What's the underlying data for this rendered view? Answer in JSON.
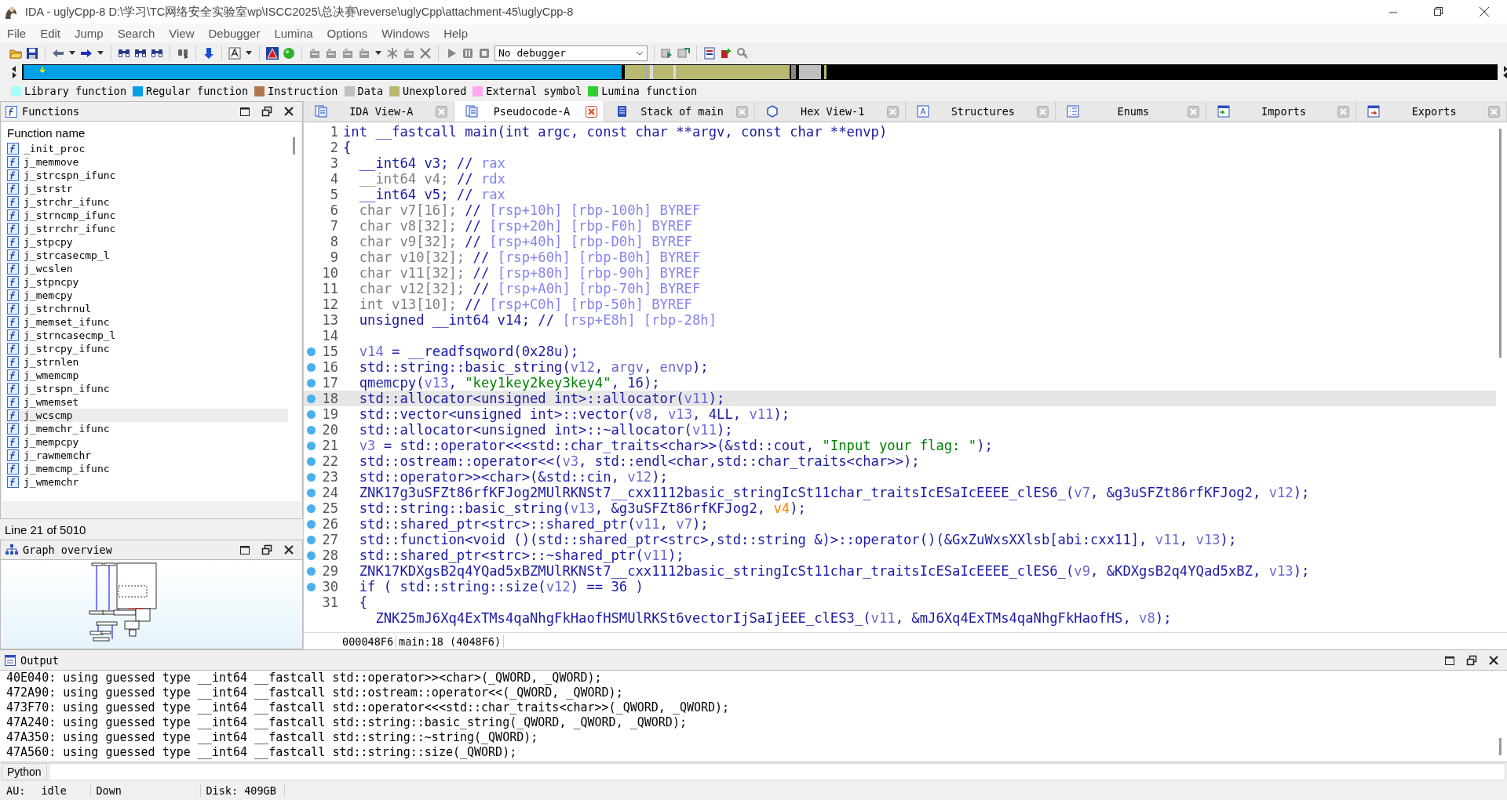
{
  "window": {
    "title": "IDA - uglyCpp-8 D:\\学习\\TC网络安全实验室wp\\ISCC2025\\总决赛\\reverse\\uglyCpp\\attachment-45\\uglyCpp-8"
  },
  "menu": [
    "File",
    "Edit",
    "Jump",
    "Search",
    "View",
    "Debugger",
    "Lumina",
    "Options",
    "Windows",
    "Help"
  ],
  "toolbar": {
    "debugger": "No debugger"
  },
  "legend": [
    {
      "label": "Library function",
      "color": "#aaffff"
    },
    {
      "label": "Regular function",
      "color": "#00a0e8"
    },
    {
      "label": "Instruction",
      "color": "#b07850"
    },
    {
      "label": "Data",
      "color": "#c0c0c0"
    },
    {
      "label": "Unexplored",
      "color": "#b8b870"
    },
    {
      "label": "External symbol",
      "color": "#ffa8f0"
    },
    {
      "label": "Lumina function",
      "color": "#30d030"
    }
  ],
  "functions_panel": {
    "title": "Functions",
    "column": "Function name",
    "status": "Line 21 of 5010",
    "items": [
      {
        "name": "_init_proc",
        "selected": false
      },
      {
        "name": "j_memmove",
        "selected": false
      },
      {
        "name": "j_strcspn_ifunc",
        "selected": false
      },
      {
        "name": "j_strstr",
        "selected": false
      },
      {
        "name": "j_strchr_ifunc",
        "selected": false
      },
      {
        "name": "j_strncmp_ifunc",
        "selected": false
      },
      {
        "name": "j_strrchr_ifunc",
        "selected": false
      },
      {
        "name": "j_stpcpy",
        "selected": false
      },
      {
        "name": "j_strcasecmp_l",
        "selected": false
      },
      {
        "name": "j_wcslen",
        "selected": false
      },
      {
        "name": "j_stpncpy",
        "selected": false
      },
      {
        "name": "j_memcpy",
        "selected": false
      },
      {
        "name": "j_strchrnul",
        "selected": false
      },
      {
        "name": "j_memset_ifunc",
        "selected": false
      },
      {
        "name": "j_strncasecmp_l",
        "selected": false
      },
      {
        "name": "j_strcpy_ifunc",
        "selected": false
      },
      {
        "name": "j_strnlen",
        "selected": false
      },
      {
        "name": "j_wmemcmp",
        "selected": false
      },
      {
        "name": "j_strspn_ifunc",
        "selected": false
      },
      {
        "name": "j_wmemset",
        "selected": false
      },
      {
        "name": "j_wcscmp",
        "selected": true
      },
      {
        "name": "j_memchr_ifunc",
        "selected": false
      },
      {
        "name": "j_mempcpy",
        "selected": false
      },
      {
        "name": "j_rawmemchr",
        "selected": false
      },
      {
        "name": "j_memcmp_ifunc",
        "selected": false
      },
      {
        "name": "j_wmemchr",
        "selected": false
      }
    ]
  },
  "graph_panel": {
    "title": "Graph overview"
  },
  "tabs": [
    {
      "label": "IDA View-A",
      "selected": false
    },
    {
      "label": "Pseudocode-A",
      "selected": true
    },
    {
      "label": "Stack of main",
      "selected": false
    },
    {
      "label": "Hex View-1",
      "selected": false
    },
    {
      "label": "Structures",
      "selected": false
    },
    {
      "label": "Enums",
      "selected": false
    },
    {
      "label": "Imports",
      "selected": false
    },
    {
      "label": "Exports",
      "selected": false
    }
  ],
  "code": {
    "address": "000048F6",
    "location": "main:18 (4048F6)",
    "lines": [
      {
        "num": "1",
        "marked": false,
        "selected": false,
        "parts": [
          {
            "kind": "c",
            "text": "int __fastcall main(int argc, const char **argv, const char **envp)"
          }
        ]
      },
      {
        "num": "2",
        "marked": false,
        "selected": false,
        "parts": [
          {
            "kind": "c",
            "text": "{"
          }
        ]
      },
      {
        "num": "3",
        "marked": false,
        "selected": false,
        "parts": [
          {
            "kind": "c",
            "text": "  __int64 v3; // "
          },
          {
            "kind": "m",
            "text": "rax"
          }
        ]
      },
      {
        "num": "4",
        "marked": false,
        "selected": false,
        "parts": [
          {
            "kind": "g",
            "text": "  __int64 v4; "
          },
          {
            "kind": "c",
            "text": "// "
          },
          {
            "kind": "m",
            "text": "rdx"
          }
        ]
      },
      {
        "num": "5",
        "marked": false,
        "selected": false,
        "parts": [
          {
            "kind": "c",
            "text": "  __int64 v5; // "
          },
          {
            "kind": "m",
            "text": "rax"
          }
        ]
      },
      {
        "num": "6",
        "marked": false,
        "selected": false,
        "parts": [
          {
            "kind": "g",
            "text": "  char v7[16]; "
          },
          {
            "kind": "c",
            "text": "// "
          },
          {
            "kind": "m",
            "text": "[rsp+10h] [rbp-100h] BYREF"
          }
        ]
      },
      {
        "num": "7",
        "marked": false,
        "selected": false,
        "parts": [
          {
            "kind": "g",
            "text": "  char v8[32]; "
          },
          {
            "kind": "c",
            "text": "// "
          },
          {
            "kind": "m",
            "text": "[rsp+20h] [rbp-F0h] BYREF"
          }
        ]
      },
      {
        "num": "8",
        "marked": false,
        "selected": false,
        "parts": [
          {
            "kind": "g",
            "text": "  char v9[32]; "
          },
          {
            "kind": "c",
            "text": "// "
          },
          {
            "kind": "m",
            "text": "[rsp+40h] [rbp-D0h] BYREF"
          }
        ]
      },
      {
        "num": "9",
        "marked": false,
        "selected": false,
        "parts": [
          {
            "kind": "g",
            "text": "  char v10[32]; "
          },
          {
            "kind": "c",
            "text": "// "
          },
          {
            "kind": "m",
            "text": "[rsp+60h] [rbp-B0h] BYREF"
          }
        ]
      },
      {
        "num": "10",
        "marked": false,
        "selected": false,
        "parts": [
          {
            "kind": "g",
            "text": "  char v11[32]; "
          },
          {
            "kind": "c",
            "text": "// "
          },
          {
            "kind": "m",
            "text": "[rsp+80h] [rbp-90h] BYREF"
          }
        ]
      },
      {
        "num": "11",
        "marked": false,
        "selected": false,
        "parts": [
          {
            "kind": "g",
            "text": "  char v12[32]; "
          },
          {
            "kind": "c",
            "text": "// "
          },
          {
            "kind": "m",
            "text": "[rsp+A0h] [rbp-70h] BYREF"
          }
        ]
      },
      {
        "num": "12",
        "marked": false,
        "selected": false,
        "parts": [
          {
            "kind": "g",
            "text": "  int v13[10]; "
          },
          {
            "kind": "c",
            "text": "// "
          },
          {
            "kind": "m",
            "text": "[rsp+C0h] [rbp-50h] BYREF"
          }
        ]
      },
      {
        "num": "13",
        "marked": false,
        "selected": false,
        "parts": [
          {
            "kind": "c",
            "text": "  unsigned __int64 v14; // "
          },
          {
            "kind": "m",
            "text": "[rsp+E8h] [rbp-28h]"
          }
        ]
      },
      {
        "num": "14",
        "marked": false,
        "selected": false
      },
      {
        "num": "15",
        "marked": true,
        "selected": false,
        "parts": [
          {
            "kind": "v",
            "text": "  v14"
          },
          {
            "kind": "c",
            "text": " = __readfsqword(0x28u);"
          }
        ]
      },
      {
        "num": "16",
        "marked": true,
        "selected": false,
        "parts": [
          {
            "kind": "c",
            "text": "  std::string::basic_string("
          },
          {
            "kind": "v",
            "text": "v12"
          },
          {
            "kind": "c",
            "text": ", "
          },
          {
            "kind": "v",
            "text": "argv"
          },
          {
            "kind": "c",
            "text": ", "
          },
          {
            "kind": "v",
            "text": "envp"
          },
          {
            "kind": "c",
            "text": ");"
          }
        ]
      },
      {
        "num": "17",
        "marked": true,
        "selected": false,
        "parts": [
          {
            "kind": "c",
            "text": "  qmemcpy("
          },
          {
            "kind": "v",
            "text": "v13"
          },
          {
            "kind": "c",
            "text": ", "
          },
          {
            "kind": "s",
            "text": "\"key1key2key3key4\""
          },
          {
            "kind": "c",
            "text": ", 16);"
          }
        ]
      },
      {
        "num": "18",
        "marked": true,
        "selected": true,
        "parts": [
          {
            "kind": "c",
            "text": "  std::allocator<unsigned int>::allocator("
          },
          {
            "kind": "v",
            "text": "v11"
          },
          {
            "kind": "c",
            "text": ");"
          }
        ]
      },
      {
        "num": "19",
        "marked": true,
        "selected": false,
        "parts": [
          {
            "kind": "c",
            "text": "  std::vector<unsigned int>::vector("
          },
          {
            "kind": "v",
            "text": "v8"
          },
          {
            "kind": "c",
            "text": ", "
          },
          {
            "kind": "v",
            "text": "v13"
          },
          {
            "kind": "c",
            "text": ", 4LL, "
          },
          {
            "kind": "v",
            "text": "v11"
          },
          {
            "kind": "c",
            "text": ");"
          }
        ]
      },
      {
        "num": "20",
        "marked": true,
        "selected": false,
        "parts": [
          {
            "kind": "c",
            "text": "  std::allocator<unsigned int>::~allocator("
          },
          {
            "kind": "v",
            "text": "v11"
          },
          {
            "kind": "c",
            "text": ");"
          }
        ]
      },
      {
        "num": "21",
        "marked": true,
        "selected": false,
        "parts": [
          {
            "kind": "v",
            "text": "  v3"
          },
          {
            "kind": "c",
            "text": " = std::operator<<<std::char_traits<char>>(&std::cout, "
          },
          {
            "kind": "s",
            "text": "\"Input your flag: \""
          },
          {
            "kind": "c",
            "text": ");"
          }
        ]
      },
      {
        "num": "22",
        "marked": true,
        "selected": false,
        "parts": [
          {
            "kind": "c",
            "text": "  std::ostream::operator<<("
          },
          {
            "kind": "v",
            "text": "v3"
          },
          {
            "kind": "c",
            "text": ", std::endl<char,std::char_traits<char>>);"
          }
        ]
      },
      {
        "num": "23",
        "marked": true,
        "selected": false,
        "parts": [
          {
            "kind": "c",
            "text": "  std::operator>><char>(&std::cin, "
          },
          {
            "kind": "v",
            "text": "v12"
          },
          {
            "kind": "c",
            "text": ");"
          }
        ]
      },
      {
        "num": "24",
        "marked": true,
        "selected": false,
        "parts": [
          {
            "kind": "c",
            "text": "  ZNK17g3uSFZt86rfKFJog2MUlRKNSt7__cxx1112basic_stringIcSt11char_traitsIcESaIcEEEE_clES6_("
          },
          {
            "kind": "v",
            "text": "v7"
          },
          {
            "kind": "c",
            "text": ", &g3uSFZt86rfKFJog2, "
          },
          {
            "kind": "v",
            "text": "v12"
          },
          {
            "kind": "c",
            "text": ");"
          }
        ]
      },
      {
        "num": "25",
        "marked": true,
        "selected": false,
        "parts": [
          {
            "kind": "c",
            "text": "  std::string::basic_string("
          },
          {
            "kind": "v",
            "text": "v13"
          },
          {
            "kind": "c",
            "text": ", &g3uSFZt86rfKFJog2, "
          },
          {
            "kind": "o",
            "text": "v4"
          },
          {
            "kind": "c",
            "text": ");"
          }
        ]
      },
      {
        "num": "26",
        "marked": true,
        "selected": false,
        "parts": [
          {
            "kind": "c",
            "text": "  std::shared_ptr<strc>::shared_ptr("
          },
          {
            "kind": "v",
            "text": "v11"
          },
          {
            "kind": "c",
            "text": ", "
          },
          {
            "kind": "v",
            "text": "v7"
          },
          {
            "kind": "c",
            "text": ");"
          }
        ]
      },
      {
        "num": "27",
        "marked": true,
        "selected": false,
        "parts": [
          {
            "kind": "c",
            "text": "  std::function<void ()(std::shared_ptr<strc>,std::string &)>::operator()(&GxZuWxsXXlsb[abi:cxx11], "
          },
          {
            "kind": "v",
            "text": "v11"
          },
          {
            "kind": "c",
            "text": ", "
          },
          {
            "kind": "v",
            "text": "v13"
          },
          {
            "kind": "c",
            "text": ");"
          }
        ]
      },
      {
        "num": "28",
        "marked": true,
        "selected": false,
        "parts": [
          {
            "kind": "c",
            "text": "  std::shared_ptr<strc>::~shared_ptr("
          },
          {
            "kind": "v",
            "text": "v11"
          },
          {
            "kind": "c",
            "text": ");"
          }
        ]
      },
      {
        "num": "29",
        "marked": true,
        "selected": false,
        "parts": [
          {
            "kind": "c",
            "text": "  ZNK17KDXgsB2q4YQad5xBZMUlRKNSt7__cxx1112basic_stringIcSt11char_traitsIcESaIcEEEE_clES6_("
          },
          {
            "kind": "v",
            "text": "v9"
          },
          {
            "kind": "c",
            "text": ", &KDXgsB2q4YQad5xBZ, "
          },
          {
            "kind": "v",
            "text": "v13"
          },
          {
            "kind": "c",
            "text": ");"
          }
        ]
      },
      {
        "num": "30",
        "marked": true,
        "selected": false,
        "parts": [
          {
            "kind": "c",
            "text": "  if ( std::string::size("
          },
          {
            "kind": "v",
            "text": "v12"
          },
          {
            "kind": "c",
            "text": ") == 36 )"
          }
        ]
      },
      {
        "num": "31",
        "marked": false,
        "selected": false,
        "parts": [
          {
            "kind": "c",
            "text": "  {"
          }
        ]
      },
      {
        "marked": false,
        "selected": false,
        "parts": [
          {
            "kind": "c",
            "text": "    ZNK25mJ6Xq4ExTMs4qaNhgFkHaofHSMUlRKSt6vectorIjSaIjEEE_clES3_("
          },
          {
            "kind": "v",
            "text": "v11"
          },
          {
            "kind": "c",
            "text": ", &mJ6Xq4ExTMs4qaNhgFkHaofHS, "
          },
          {
            "kind": "v",
            "text": "v8"
          },
          {
            "kind": "c",
            "text": ");"
          }
        ]
      }
    ]
  },
  "output": {
    "title": "Output",
    "lines": [
      "40E040: using guessed type __int64 __fastcall std::operator>><char>(_QWORD, _QWORD);",
      "472A90: using guessed type __int64 __fastcall std::ostream::operator<<(_QWORD, _QWORD);",
      "473F70: using guessed type __int64 __fastcall std::operator<<<std::char_traits<char>>(_QWORD, _QWORD);",
      "47A240: using guessed type __int64 __fastcall std::string::basic_string(_QWORD, _QWORD, _QWORD);",
      "47A350: using guessed type __int64 __fastcall std::string::~string(_QWORD);",
      "47A560: using guessed type __int64 __fastcall std::string::size(_QWORD);"
    ]
  },
  "python": {
    "button": "Python"
  },
  "status_bar": [
    "AU:",
    "idle",
    "Down",
    "Disk: 409GB"
  ]
}
